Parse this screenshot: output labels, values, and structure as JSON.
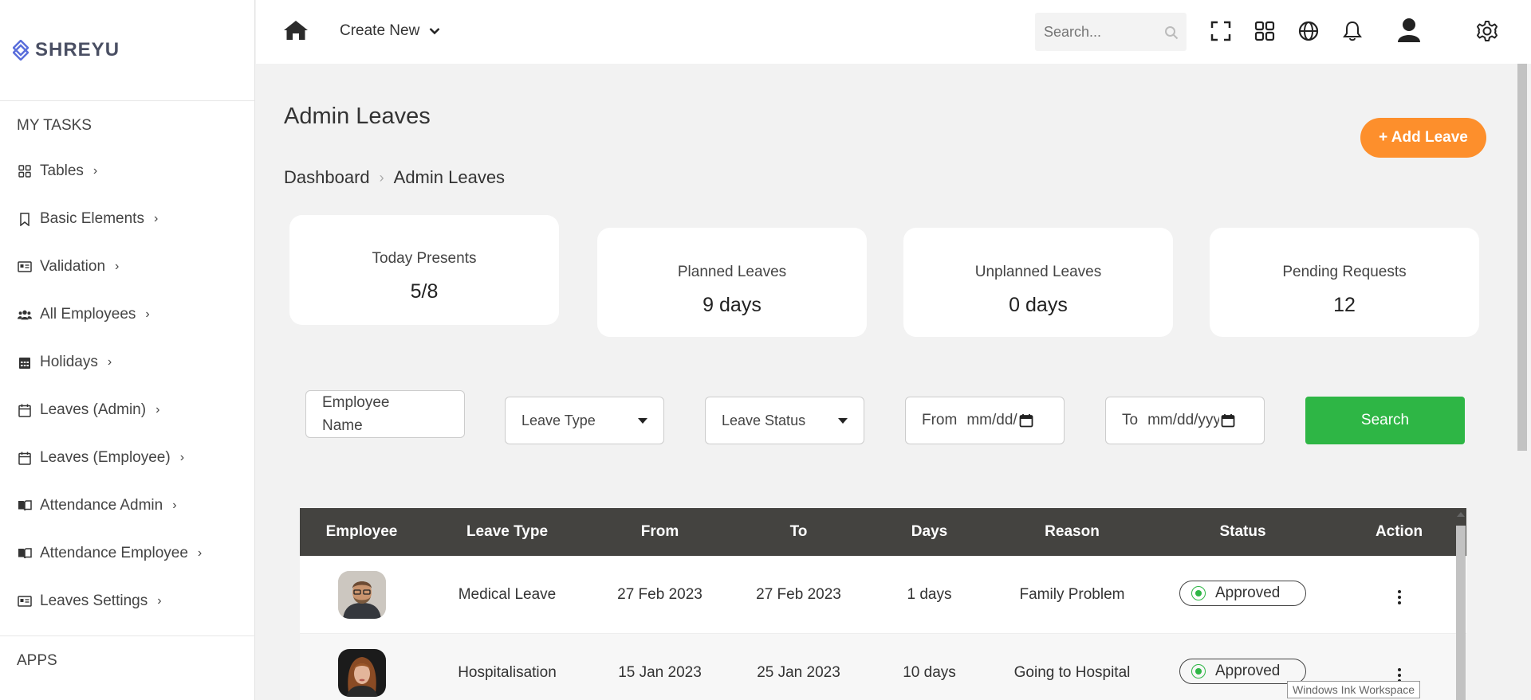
{
  "app": {
    "brand": "SHREYU"
  },
  "sidebar": {
    "section_tasks": "MY TASKS",
    "items": [
      {
        "label": "Tables",
        "icon": "grid-icon"
      },
      {
        "label": "Basic Elements",
        "icon": "bookmark-icon"
      },
      {
        "label": "Validation",
        "icon": "id-card-icon"
      },
      {
        "label": "All Employees",
        "icon": "users-icon"
      },
      {
        "label": "Holidays",
        "icon": "calendar-grid-icon"
      },
      {
        "label": "Leaves (Admin)",
        "icon": "calendar-icon"
      },
      {
        "label": "Leaves (Employee)",
        "icon": "calendar-icon"
      },
      {
        "label": "Attendance Admin",
        "icon": "book-open-icon"
      },
      {
        "label": "Attendance Employee",
        "icon": "book-open-icon"
      },
      {
        "label": "Leaves Settings",
        "icon": "id-card-icon"
      }
    ],
    "section_apps": "APPS"
  },
  "topbar": {
    "create_new": "Create New",
    "search_placeholder": "Search..."
  },
  "page": {
    "title": "Admin Leaves",
    "breadcrumb": [
      "Dashboard",
      "Admin Leaves"
    ],
    "add_button": "+ Add Leave"
  },
  "stats": [
    {
      "label": "Today Presents",
      "value": "5/8"
    },
    {
      "label": "Planned Leaves",
      "value": "9 days"
    },
    {
      "label": "Unplanned Leaves",
      "value": "0 days"
    },
    {
      "label": "Pending Requests",
      "value": "12"
    }
  ],
  "filters": {
    "employee_name": "Employee Name",
    "leave_type": "Leave Type",
    "leave_status": "Leave Status",
    "from_label": "From",
    "from_value": "mm/dd/",
    "to_label": "To",
    "to_value": "mm/dd/yyy",
    "search_button": "Search"
  },
  "table": {
    "headers": [
      "Employee",
      "Leave Type",
      "From",
      "To",
      "Days",
      "Reason",
      "Status",
      "Action"
    ],
    "rows": [
      {
        "leave_type": "Medical Leave",
        "from": "27 Feb 2023",
        "to": "27 Feb 2023",
        "days": "1 days",
        "reason": "Family Problem",
        "status": "Approved"
      },
      {
        "leave_type": "Hospitalisation",
        "from": "15 Jan 2023",
        "to": "25 Jan 2023",
        "days": "10 days",
        "reason": "Going to Hospital",
        "status": "Approved"
      }
    ]
  },
  "tooltip": "Windows Ink Workspace",
  "colors": {
    "accent_orange": "#fd8f2c",
    "success_green": "#2eb645",
    "table_header": "#444340",
    "brand_blue": "#5a6edb"
  }
}
